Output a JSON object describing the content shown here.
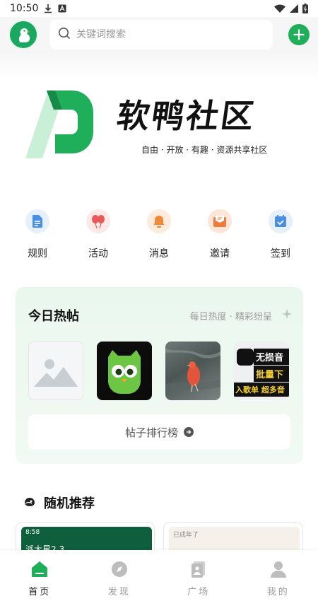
{
  "status_bar": {
    "time": "10:50"
  },
  "search": {
    "placeholder": "关键词搜索"
  },
  "banner": {
    "title": "软鸭社区",
    "slogan": "自由 · 开放 · 有趣 · 资源共享社区"
  },
  "quick_actions": [
    {
      "label": "规则",
      "icon": "document-icon",
      "color": "#4a90e2"
    },
    {
      "label": "活动",
      "icon": "balloons-icon",
      "color": "#e85a5a"
    },
    {
      "label": "消息",
      "icon": "bell-icon",
      "color": "#f08a3a"
    },
    {
      "label": "邀请",
      "icon": "envelope-icon",
      "color": "#f07a3a"
    },
    {
      "label": "签到",
      "icon": "calendar-check-icon",
      "color": "#4a90e2"
    }
  ],
  "hot_posts": {
    "title": "今日热帖",
    "subtitle": "每日热度 · 精彩纷呈",
    "thumb_music_lines": [
      "无损音",
      "批量下",
      "入歌单 超多音"
    ],
    "rank_button": "帖子排行榜"
  },
  "recommend": {
    "title": "随机推荐",
    "card_a": {
      "time": "8:58",
      "text": "派大星2.3"
    },
    "card_b": {
      "text": "已成年了"
    }
  },
  "bottom_nav": [
    {
      "label": "首页",
      "icon": "home-icon",
      "active": true
    },
    {
      "label": "发现",
      "icon": "compass-icon",
      "active": false
    },
    {
      "label": "广场",
      "icon": "square-icon",
      "active": false
    },
    {
      "label": "我的",
      "icon": "profile-icon",
      "active": false
    }
  ],
  "colors": {
    "brand_green": "#1fae5a",
    "card_bg": "#eaf7ee"
  }
}
